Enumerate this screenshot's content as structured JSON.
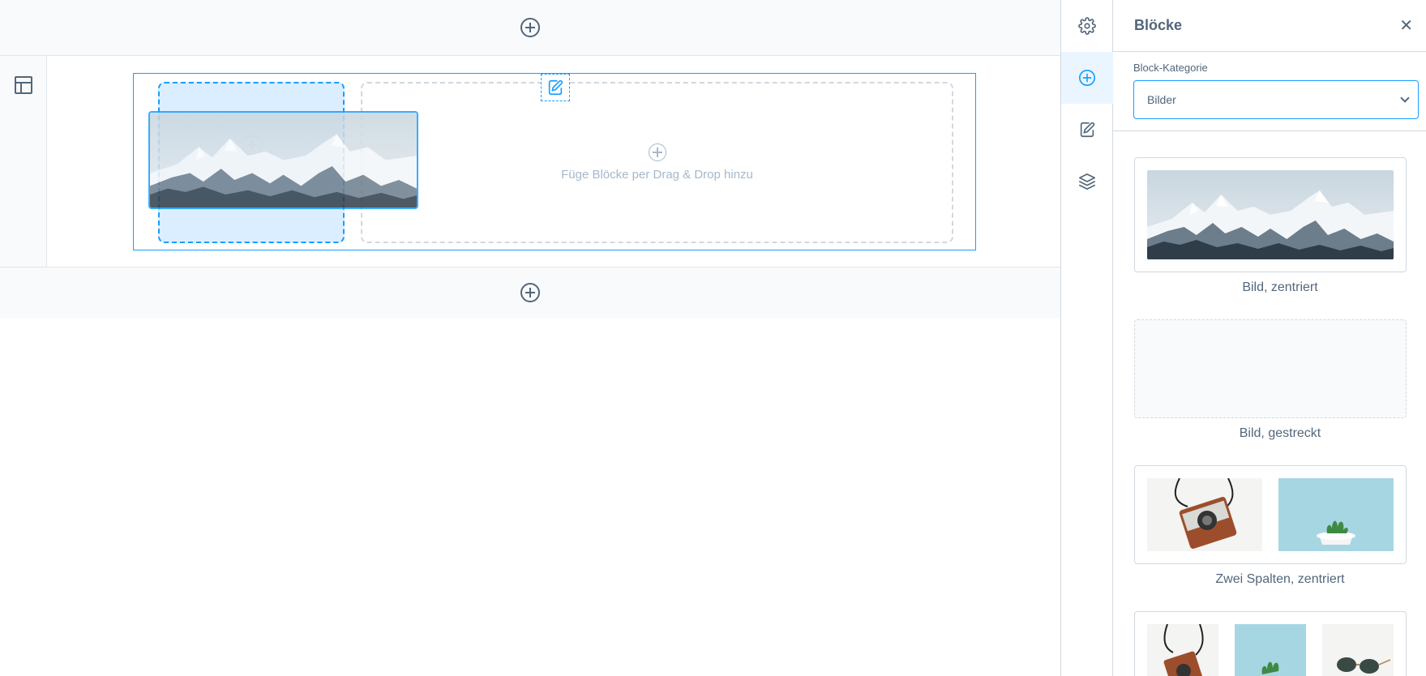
{
  "canvas": {
    "drop_hint": "Füge Blöcke per Drag & Drop hinzu"
  },
  "rail": {
    "items": [
      {
        "icon": "gear-icon"
      },
      {
        "icon": "plus-circle-icon",
        "active": true
      },
      {
        "icon": "edit-icon"
      },
      {
        "icon": "layers-icon"
      }
    ]
  },
  "panel": {
    "title": "Blöcke",
    "category_label": "Block-Kategorie",
    "category_value": "Bilder",
    "blocks": [
      {
        "label": "Bild, zentriert"
      },
      {
        "label": "Bild, gestreckt"
      },
      {
        "label": "Zwei Spalten, zentriert"
      }
    ]
  },
  "colors": {
    "accent": "#189eff",
    "text": "#52667a",
    "border": "#d1d9e0",
    "canvas_bg": "#f9fafb"
  }
}
